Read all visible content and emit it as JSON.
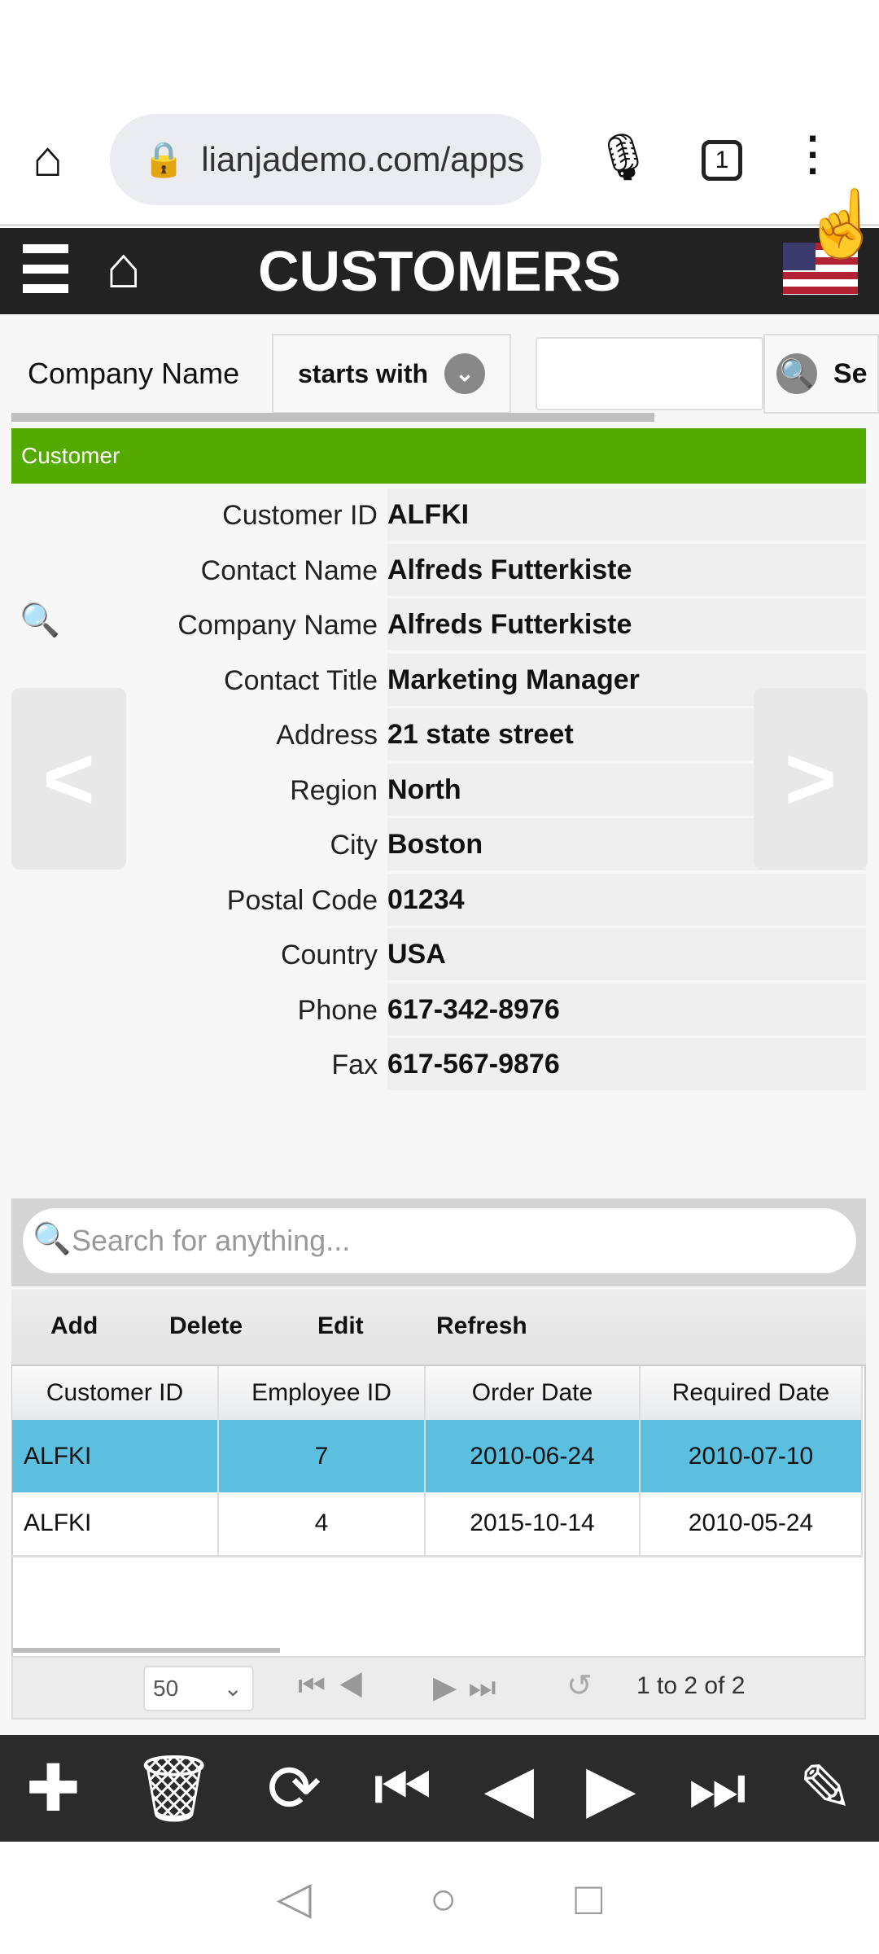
{
  "browser": {
    "url": "lianjademo.com/apps",
    "tab_count": "1"
  },
  "app": {
    "title": "CUSTOMERS"
  },
  "filter": {
    "field_label": "Company Name",
    "operator": "starts with",
    "value": "",
    "search_label": "Se"
  },
  "section": {
    "title": "Customer",
    "color": "#55aa00"
  },
  "fields": [
    {
      "label": "Customer ID",
      "value": "ALFKI"
    },
    {
      "label": "Contact Name",
      "value": "Alfreds Futterkiste"
    },
    {
      "label": "Company Name",
      "value": "Alfreds Futterkiste"
    },
    {
      "label": "Contact Title",
      "value": "Marketing Manager"
    },
    {
      "label": "Address",
      "value": "21 state street"
    },
    {
      "label": "Region",
      "value": "North"
    },
    {
      "label": "City",
      "value": "Boston"
    },
    {
      "label": "Postal Code",
      "value": "01234"
    },
    {
      "label": "Country",
      "value": "USA"
    },
    {
      "label": "Phone",
      "value": "617-342-8976"
    },
    {
      "label": "Fax",
      "value": "617-567-9876"
    }
  ],
  "nav": {
    "prev": "<",
    "next": ">"
  },
  "grid": {
    "search_placeholder": "Search for anything...",
    "toolbar": [
      "Add",
      "Delete",
      "Edit",
      "Refresh"
    ],
    "columns": [
      "Customer ID",
      "Employee ID",
      "Order Date",
      "Required Date"
    ],
    "rows": [
      [
        "ALFKI",
        "7",
        "2010-06-24",
        "2010-07-10"
      ],
      [
        "ALFKI",
        "4",
        "2015-10-14",
        "2010-05-24"
      ]
    ],
    "selected_color": "#5bbfdf",
    "page_size": "50",
    "status": "1 to 2 of 2"
  }
}
